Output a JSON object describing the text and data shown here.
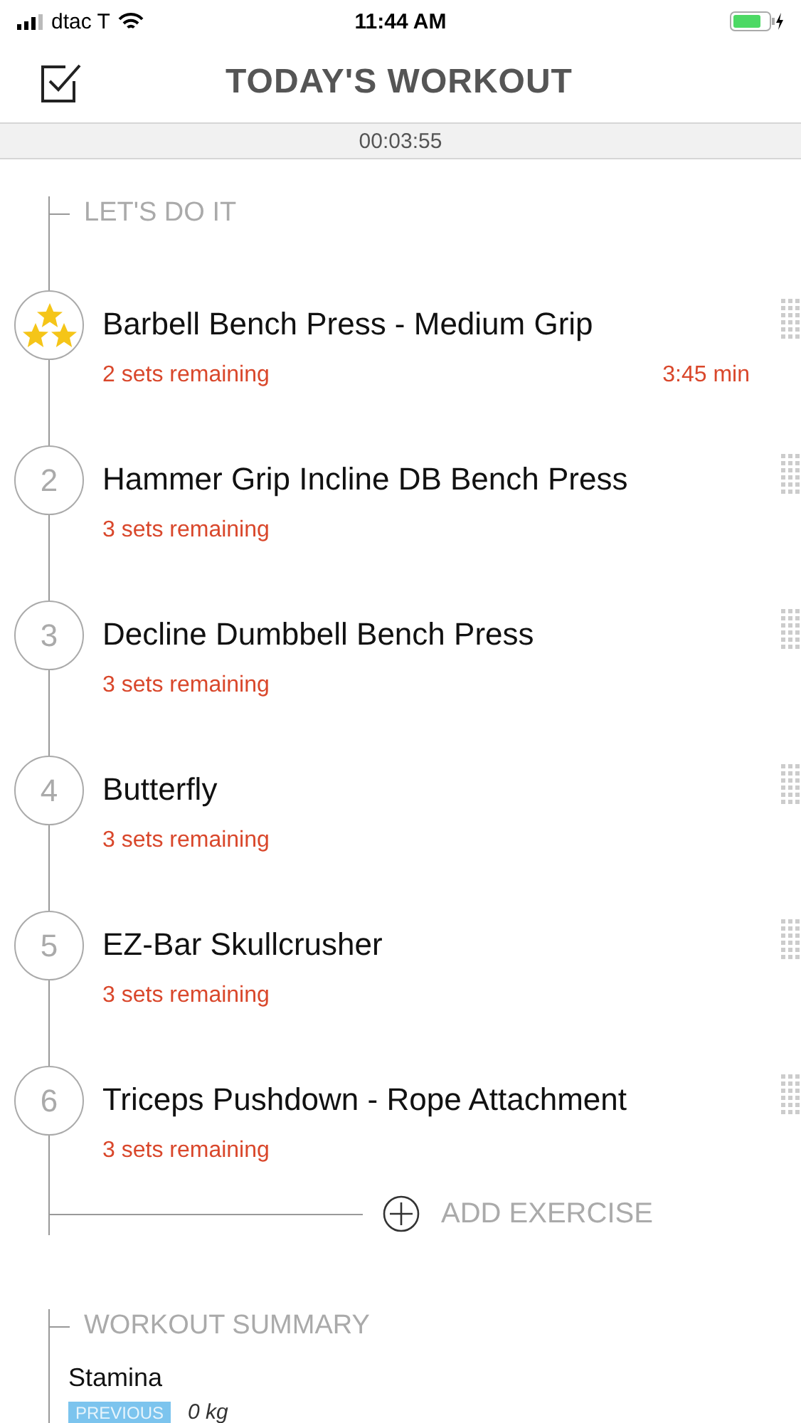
{
  "status_bar": {
    "carrier": "dtac T",
    "time": "11:44 AM"
  },
  "header": {
    "title": "TODAY'S WORKOUT",
    "timer": "00:03:55"
  },
  "plan": {
    "heading": "LET'S DO IT",
    "add_label": "ADD EXERCISE",
    "exercises": [
      {
        "kind": "stars",
        "name": "Barbell Bench Press - Medium Grip",
        "sets": "2 sets remaining",
        "rest": "3:45 min"
      },
      {
        "kind": "number",
        "number": "2",
        "name": "Hammer Grip Incline DB Bench Press",
        "sets": "3 sets remaining"
      },
      {
        "kind": "number",
        "number": "3",
        "name": "Decline Dumbbell Bench Press",
        "sets": "3 sets remaining"
      },
      {
        "kind": "number",
        "number": "4",
        "name": "Butterfly",
        "sets": "3 sets remaining"
      },
      {
        "kind": "number",
        "number": "5",
        "name": "EZ-Bar Skullcrusher",
        "sets": "3 sets remaining"
      },
      {
        "kind": "number",
        "number": "6",
        "name": "Triceps Pushdown - Rope Attachment",
        "sets": "3 sets remaining"
      }
    ]
  },
  "summary": {
    "heading": "WORKOUT SUMMARY",
    "metric": "Stamina",
    "badge": "PREVIOUS",
    "value": "0 kg"
  }
}
